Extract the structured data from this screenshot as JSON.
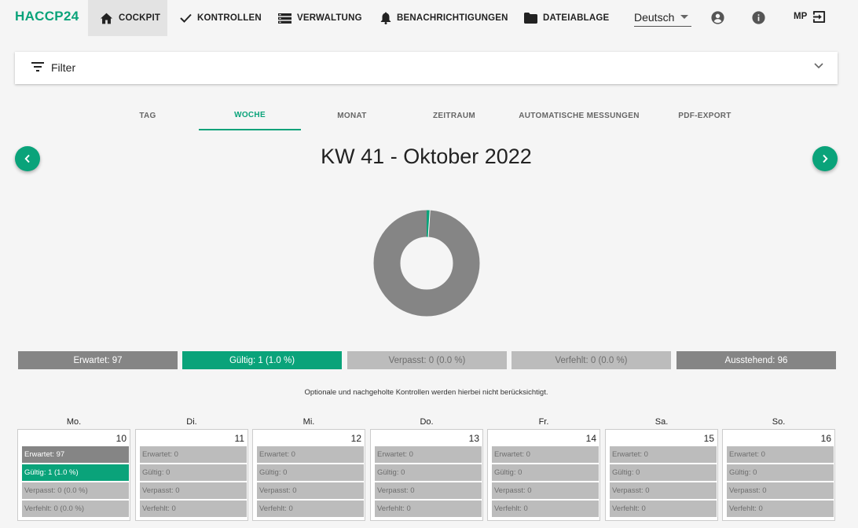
{
  "app": {
    "brand": "HACCP24"
  },
  "nav": {
    "cockpit": "COCKPIT",
    "kontrollen": "KONTROLLEN",
    "verwaltung": "VERWALTUNG",
    "benachrichtigungen": "BENACHRICHTIGUNGEN",
    "dateiablage": "DATEIABLAGE",
    "language": "Deutsch",
    "user_initials": "MP"
  },
  "filter": {
    "label": "Filter"
  },
  "tabs": [
    "TAG",
    "WOCHE",
    "MONAT",
    "ZEITRAUM",
    "AUTOMATISCHE MESSUNGEN",
    "PDF-EXPORT"
  ],
  "active_tab": "WOCHE",
  "week": {
    "title": "KW 41 - Oktober 2022"
  },
  "donut": {
    "valid_percent": 1.0,
    "colors": {
      "valid": "#0aa37a",
      "remaining": "#858585"
    }
  },
  "summary": {
    "erwartet": "Erwartet:  97",
    "gueltig": "Gültig:  1 (1.0 %)",
    "verpasst": "Verpasst:  0 (0.0 %)",
    "verfehlt": "Verfehlt:  0 (0.0 %)",
    "ausstehend": "Ausstehend:  96"
  },
  "note": "Optionale und nachgeholte Kontrollen werden hierbei nicht berücksichtigt.",
  "colors": {
    "accent": "#0aa37a",
    "dark_gray": "#858585",
    "light_gray": "#bcbcbc"
  },
  "days": [
    {
      "name": "Mo.",
      "date": "10",
      "rows": [
        "Erwartet: 97",
        "Gültig: 1 (1.0 %)",
        "Verpasst: 0 (0.0 %)",
        "Verfehlt: 0 (0.0 %)"
      ]
    },
    {
      "name": "Di.",
      "date": "11",
      "rows": [
        "Erwartet: 0",
        "Gültig: 0",
        "Verpasst: 0",
        "Verfehlt: 0"
      ]
    },
    {
      "name": "Mi.",
      "date": "12",
      "rows": [
        "Erwartet: 0",
        "Gültig: 0",
        "Verpasst: 0",
        "Verfehlt: 0"
      ]
    },
    {
      "name": "Do.",
      "date": "13",
      "rows": [
        "Erwartet: 0",
        "Gültig: 0",
        "Verpasst: 0",
        "Verfehlt: 0"
      ]
    },
    {
      "name": "Fr.",
      "date": "14",
      "rows": [
        "Erwartet: 0",
        "Gültig: 0",
        "Verpasst: 0",
        "Verfehlt: 0"
      ]
    },
    {
      "name": "Sa.",
      "date": "15",
      "rows": [
        "Erwartet: 0",
        "Gültig: 0",
        "Verpasst: 0",
        "Verfehlt: 0"
      ]
    },
    {
      "name": "So.",
      "date": "16",
      "rows": [
        "Erwartet: 0",
        "Gültig: 0",
        "Verpasst: 0",
        "Verfehlt: 0"
      ]
    }
  ]
}
